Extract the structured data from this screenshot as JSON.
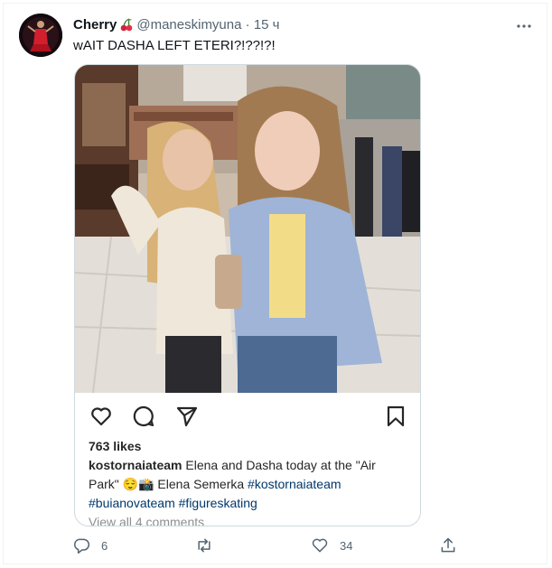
{
  "tweet": {
    "display_name": "Cherry",
    "name_emoji": "cherries-emoji",
    "handle": "@maneskimyuna",
    "separator": "·",
    "time": "15 ч",
    "text": "wAIT DASHA LEFT ETERI?!??!?!"
  },
  "instagram": {
    "likes": "763 likes",
    "caption": {
      "user": "kostornaiateam",
      "text": " Elena and Dasha today at the \"Air Park\" ",
      "emoji": "😌📸",
      "credit": " Elena Semerka ",
      "tag1": "#kostornaiateam",
      "tag2": "#buianovateam",
      "tag3": "#figureskating"
    },
    "view_comments": "View all 4 comments"
  },
  "actions": {
    "reply_count": "6",
    "retweet_count": "",
    "like_count": "34"
  },
  "colors": {
    "text": "#0f1419",
    "secondary": "#536471",
    "border": "#cfd9de",
    "hashtag": "#00376b"
  }
}
